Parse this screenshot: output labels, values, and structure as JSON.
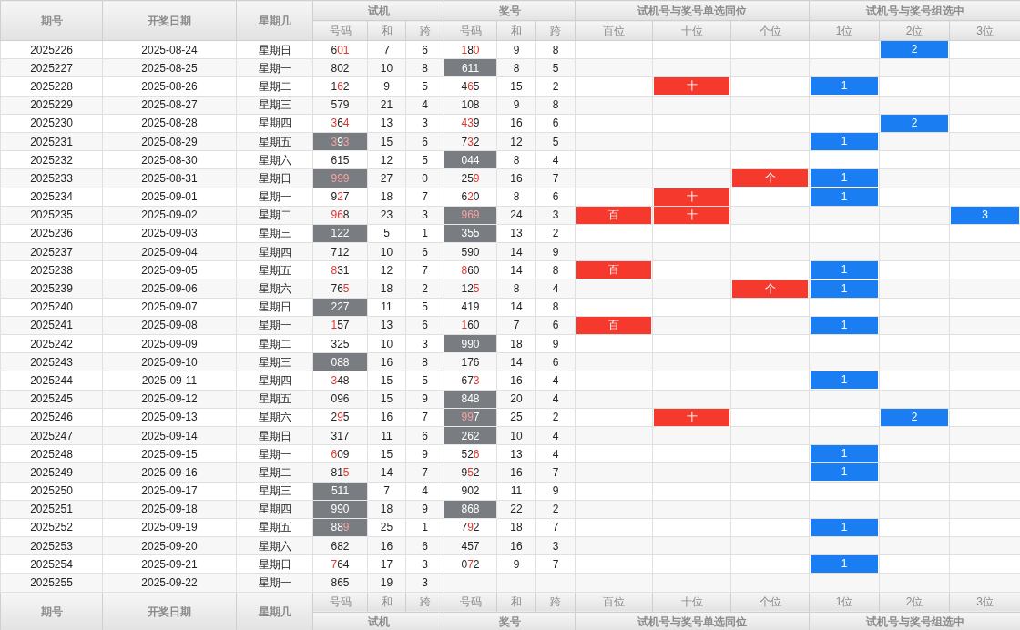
{
  "header": {
    "fixed": [
      "期号",
      "开奖日期",
      "星期几"
    ],
    "groups": [
      {
        "title": "试机",
        "columns": [
          "号码",
          "和",
          "跨"
        ]
      },
      {
        "title": "奖号",
        "columns": [
          "号码",
          "和",
          "跨"
        ]
      },
      {
        "title": "试机号与奖号单选同位",
        "columns": [
          "百位",
          "十位",
          "个位"
        ]
      },
      {
        "title": "试机号与奖号组选中",
        "columns": [
          "1位",
          "2位",
          "3位"
        ]
      }
    ]
  },
  "rows": [
    {
      "issue": "2025226",
      "date": "2025-08-24",
      "weekday": "星期日",
      "trial": {
        "highlighted": false,
        "digits": [
          {
            "d": "6",
            "red": false
          },
          {
            "d": "0",
            "red": true
          },
          {
            "d": "1",
            "red": true
          }
        ],
        "sum": "7",
        "span": "6"
      },
      "draw": {
        "highlighted": false,
        "digits": [
          {
            "d": "1",
            "red": true
          },
          {
            "d": "8",
            "red": false
          },
          {
            "d": "0",
            "red": true
          }
        ],
        "sum": "9",
        "span": "8"
      },
      "hits": [
        {
          "kind": "group2",
          "text": "2"
        }
      ]
    },
    {
      "issue": "2025227",
      "date": "2025-08-25",
      "weekday": "星期一",
      "trial": {
        "highlighted": false,
        "digits": [
          {
            "d": "8",
            "red": false
          },
          {
            "d": "0",
            "red": false
          },
          {
            "d": "2",
            "red": false
          }
        ],
        "sum": "10",
        "span": "8"
      },
      "draw": {
        "highlighted": true,
        "digits": [
          {
            "d": "6",
            "red": false
          },
          {
            "d": "1",
            "red": false
          },
          {
            "d": "1",
            "red": false
          }
        ],
        "sum": "8",
        "span": "5"
      },
      "hits": []
    },
    {
      "issue": "2025228",
      "date": "2025-08-26",
      "weekday": "星期二",
      "trial": {
        "highlighted": false,
        "digits": [
          {
            "d": "1",
            "red": false
          },
          {
            "d": "6",
            "red": true
          },
          {
            "d": "2",
            "red": false
          }
        ],
        "sum": "9",
        "span": "5"
      },
      "draw": {
        "highlighted": false,
        "digits": [
          {
            "d": "4",
            "red": false
          },
          {
            "d": "6",
            "red": true
          },
          {
            "d": "5",
            "red": false
          }
        ],
        "sum": "15",
        "span": "2"
      },
      "hits": [
        {
          "kind": "tens",
          "text": "十"
        },
        {
          "kind": "group1",
          "text": "1"
        }
      ]
    },
    {
      "issue": "2025229",
      "date": "2025-08-27",
      "weekday": "星期三",
      "trial": {
        "highlighted": false,
        "digits": [
          {
            "d": "5",
            "red": false
          },
          {
            "d": "7",
            "red": false
          },
          {
            "d": "9",
            "red": false
          }
        ],
        "sum": "21",
        "span": "4"
      },
      "draw": {
        "highlighted": false,
        "digits": [
          {
            "d": "1",
            "red": false
          },
          {
            "d": "0",
            "red": false
          },
          {
            "d": "8",
            "red": false
          }
        ],
        "sum": "9",
        "span": "8"
      },
      "hits": []
    },
    {
      "issue": "2025230",
      "date": "2025-08-28",
      "weekday": "星期四",
      "trial": {
        "highlighted": false,
        "digits": [
          {
            "d": "3",
            "red": true
          },
          {
            "d": "6",
            "red": false
          },
          {
            "d": "4",
            "red": true
          }
        ],
        "sum": "13",
        "span": "3"
      },
      "draw": {
        "highlighted": false,
        "digits": [
          {
            "d": "4",
            "red": true
          },
          {
            "d": "3",
            "red": true
          },
          {
            "d": "9",
            "red": false
          }
        ],
        "sum": "16",
        "span": "6"
      },
      "hits": [
        {
          "kind": "group2",
          "text": "2"
        }
      ]
    },
    {
      "issue": "2025231",
      "date": "2025-08-29",
      "weekday": "星期五",
      "trial": {
        "highlighted": true,
        "digits": [
          {
            "d": "3",
            "red": true
          },
          {
            "d": "9",
            "red": false
          },
          {
            "d": "3",
            "red": true
          }
        ],
        "sum": "15",
        "span": "6"
      },
      "draw": {
        "highlighted": false,
        "digits": [
          {
            "d": "7",
            "red": false
          },
          {
            "d": "3",
            "red": true
          },
          {
            "d": "2",
            "red": false
          }
        ],
        "sum": "12",
        "span": "5"
      },
      "hits": [
        {
          "kind": "group1",
          "text": "1"
        }
      ]
    },
    {
      "issue": "2025232",
      "date": "2025-08-30",
      "weekday": "星期六",
      "trial": {
        "highlighted": false,
        "digits": [
          {
            "d": "6",
            "red": false
          },
          {
            "d": "1",
            "red": false
          },
          {
            "d": "5",
            "red": false
          }
        ],
        "sum": "12",
        "span": "5"
      },
      "draw": {
        "highlighted": true,
        "digits": [
          {
            "d": "0",
            "red": false
          },
          {
            "d": "4",
            "red": false
          },
          {
            "d": "4",
            "red": false
          }
        ],
        "sum": "8",
        "span": "4"
      },
      "hits": []
    },
    {
      "issue": "2025233",
      "date": "2025-08-31",
      "weekday": "星期日",
      "trial": {
        "highlighted": true,
        "digits": [
          {
            "d": "9",
            "red": true
          },
          {
            "d": "9",
            "red": true
          },
          {
            "d": "9",
            "red": true
          }
        ],
        "sum": "27",
        "span": "0"
      },
      "draw": {
        "highlighted": false,
        "digits": [
          {
            "d": "2",
            "red": false
          },
          {
            "d": "5",
            "red": false
          },
          {
            "d": "9",
            "red": true
          }
        ],
        "sum": "16",
        "span": "7"
      },
      "hits": [
        {
          "kind": "units",
          "text": "个"
        },
        {
          "kind": "group1",
          "text": "1"
        }
      ]
    },
    {
      "issue": "2025234",
      "date": "2025-09-01",
      "weekday": "星期一",
      "trial": {
        "highlighted": false,
        "digits": [
          {
            "d": "9",
            "red": false
          },
          {
            "d": "2",
            "red": true
          },
          {
            "d": "7",
            "red": false
          }
        ],
        "sum": "18",
        "span": "7"
      },
      "draw": {
        "highlighted": false,
        "digits": [
          {
            "d": "6",
            "red": false
          },
          {
            "d": "2",
            "red": true
          },
          {
            "d": "0",
            "red": false
          }
        ],
        "sum": "8",
        "span": "6"
      },
      "hits": [
        {
          "kind": "tens",
          "text": "十"
        },
        {
          "kind": "group1",
          "text": "1"
        }
      ]
    },
    {
      "issue": "2025235",
      "date": "2025-09-02",
      "weekday": "星期二",
      "trial": {
        "highlighted": false,
        "digits": [
          {
            "d": "9",
            "red": true
          },
          {
            "d": "6",
            "red": true
          },
          {
            "d": "8",
            "red": false
          }
        ],
        "sum": "23",
        "span": "3"
      },
      "draw": {
        "highlighted": true,
        "digits": [
          {
            "d": "9",
            "red": true
          },
          {
            "d": "6",
            "red": true
          },
          {
            "d": "9",
            "red": true
          }
        ],
        "sum": "24",
        "span": "3"
      },
      "hits": [
        {
          "kind": "hundreds",
          "text": "百"
        },
        {
          "kind": "tens",
          "text": "十"
        },
        {
          "kind": "group3",
          "text": "3"
        }
      ]
    },
    {
      "issue": "2025236",
      "date": "2025-09-03",
      "weekday": "星期三",
      "trial": {
        "highlighted": true,
        "digits": [
          {
            "d": "1",
            "red": false
          },
          {
            "d": "2",
            "red": false
          },
          {
            "d": "2",
            "red": false
          }
        ],
        "sum": "5",
        "span": "1"
      },
      "draw": {
        "highlighted": true,
        "digits": [
          {
            "d": "3",
            "red": false
          },
          {
            "d": "5",
            "red": false
          },
          {
            "d": "5",
            "red": false
          }
        ],
        "sum": "13",
        "span": "2"
      },
      "hits": []
    },
    {
      "issue": "2025237",
      "date": "2025-09-04",
      "weekday": "星期四",
      "trial": {
        "highlighted": false,
        "digits": [
          {
            "d": "7",
            "red": false
          },
          {
            "d": "1",
            "red": false
          },
          {
            "d": "2",
            "red": false
          }
        ],
        "sum": "10",
        "span": "6"
      },
      "draw": {
        "highlighted": false,
        "digits": [
          {
            "d": "5",
            "red": false
          },
          {
            "d": "9",
            "red": false
          },
          {
            "d": "0",
            "red": false
          }
        ],
        "sum": "14",
        "span": "9"
      },
      "hits": []
    },
    {
      "issue": "2025238",
      "date": "2025-09-05",
      "weekday": "星期五",
      "trial": {
        "highlighted": false,
        "digits": [
          {
            "d": "8",
            "red": true
          },
          {
            "d": "3",
            "red": false
          },
          {
            "d": "1",
            "red": false
          }
        ],
        "sum": "12",
        "span": "7"
      },
      "draw": {
        "highlighted": false,
        "digits": [
          {
            "d": "8",
            "red": true
          },
          {
            "d": "6",
            "red": false
          },
          {
            "d": "0",
            "red": false
          }
        ],
        "sum": "14",
        "span": "8"
      },
      "hits": [
        {
          "kind": "hundreds",
          "text": "百"
        },
        {
          "kind": "group1",
          "text": "1"
        }
      ]
    },
    {
      "issue": "2025239",
      "date": "2025-09-06",
      "weekday": "星期六",
      "trial": {
        "highlighted": false,
        "digits": [
          {
            "d": "7",
            "red": false
          },
          {
            "d": "6",
            "red": false
          },
          {
            "d": "5",
            "red": true
          }
        ],
        "sum": "18",
        "span": "2"
      },
      "draw": {
        "highlighted": false,
        "digits": [
          {
            "d": "1",
            "red": false
          },
          {
            "d": "2",
            "red": false
          },
          {
            "d": "5",
            "red": true
          }
        ],
        "sum": "8",
        "span": "4"
      },
      "hits": [
        {
          "kind": "units",
          "text": "个"
        },
        {
          "kind": "group1",
          "text": "1"
        }
      ]
    },
    {
      "issue": "2025240",
      "date": "2025-09-07",
      "weekday": "星期日",
      "trial": {
        "highlighted": true,
        "digits": [
          {
            "d": "2",
            "red": false
          },
          {
            "d": "2",
            "red": false
          },
          {
            "d": "7",
            "red": false
          }
        ],
        "sum": "11",
        "span": "5"
      },
      "draw": {
        "highlighted": false,
        "digits": [
          {
            "d": "4",
            "red": false
          },
          {
            "d": "1",
            "red": false
          },
          {
            "d": "9",
            "red": false
          }
        ],
        "sum": "14",
        "span": "8"
      },
      "hits": []
    },
    {
      "issue": "2025241",
      "date": "2025-09-08",
      "weekday": "星期一",
      "trial": {
        "highlighted": false,
        "digits": [
          {
            "d": "1",
            "red": true
          },
          {
            "d": "5",
            "red": false
          },
          {
            "d": "7",
            "red": false
          }
        ],
        "sum": "13",
        "span": "6"
      },
      "draw": {
        "highlighted": false,
        "digits": [
          {
            "d": "1",
            "red": true
          },
          {
            "d": "6",
            "red": false
          },
          {
            "d": "0",
            "red": false
          }
        ],
        "sum": "7",
        "span": "6"
      },
      "hits": [
        {
          "kind": "hundreds",
          "text": "百"
        },
        {
          "kind": "group1",
          "text": "1"
        }
      ]
    },
    {
      "issue": "2025242",
      "date": "2025-09-09",
      "weekday": "星期二",
      "trial": {
        "highlighted": false,
        "digits": [
          {
            "d": "3",
            "red": false
          },
          {
            "d": "2",
            "red": false
          },
          {
            "d": "5",
            "red": false
          }
        ],
        "sum": "10",
        "span": "3"
      },
      "draw": {
        "highlighted": true,
        "digits": [
          {
            "d": "9",
            "red": false
          },
          {
            "d": "9",
            "red": false
          },
          {
            "d": "0",
            "red": false
          }
        ],
        "sum": "18",
        "span": "9"
      },
      "hits": []
    },
    {
      "issue": "2025243",
      "date": "2025-09-10",
      "weekday": "星期三",
      "trial": {
        "highlighted": true,
        "digits": [
          {
            "d": "0",
            "red": false
          },
          {
            "d": "8",
            "red": false
          },
          {
            "d": "8",
            "red": false
          }
        ],
        "sum": "16",
        "span": "8"
      },
      "draw": {
        "highlighted": false,
        "digits": [
          {
            "d": "1",
            "red": false
          },
          {
            "d": "7",
            "red": false
          },
          {
            "d": "6",
            "red": false
          }
        ],
        "sum": "14",
        "span": "6"
      },
      "hits": []
    },
    {
      "issue": "2025244",
      "date": "2025-09-11",
      "weekday": "星期四",
      "trial": {
        "highlighted": false,
        "digits": [
          {
            "d": "3",
            "red": true
          },
          {
            "d": "4",
            "red": false
          },
          {
            "d": "8",
            "red": false
          }
        ],
        "sum": "15",
        "span": "5"
      },
      "draw": {
        "highlighted": false,
        "digits": [
          {
            "d": "6",
            "red": false
          },
          {
            "d": "7",
            "red": false
          },
          {
            "d": "3",
            "red": true
          }
        ],
        "sum": "16",
        "span": "4"
      },
      "hits": [
        {
          "kind": "group1",
          "text": "1"
        }
      ]
    },
    {
      "issue": "2025245",
      "date": "2025-09-12",
      "weekday": "星期五",
      "trial": {
        "highlighted": false,
        "digits": [
          {
            "d": "0",
            "red": false
          },
          {
            "d": "9",
            "red": false
          },
          {
            "d": "6",
            "red": false
          }
        ],
        "sum": "15",
        "span": "9"
      },
      "draw": {
        "highlighted": true,
        "digits": [
          {
            "d": "8",
            "red": false
          },
          {
            "d": "4",
            "red": false
          },
          {
            "d": "8",
            "red": false
          }
        ],
        "sum": "20",
        "span": "4"
      },
      "hits": []
    },
    {
      "issue": "2025246",
      "date": "2025-09-13",
      "weekday": "星期六",
      "trial": {
        "highlighted": false,
        "digits": [
          {
            "d": "2",
            "red": false
          },
          {
            "d": "9",
            "red": true
          },
          {
            "d": "5",
            "red": false
          }
        ],
        "sum": "16",
        "span": "7"
      },
      "draw": {
        "highlighted": true,
        "digits": [
          {
            "d": "9",
            "red": true
          },
          {
            "d": "9",
            "red": true
          },
          {
            "d": "7",
            "red": false
          }
        ],
        "sum": "25",
        "span": "2"
      },
      "hits": [
        {
          "kind": "tens",
          "text": "十"
        },
        {
          "kind": "group2",
          "text": "2"
        }
      ]
    },
    {
      "issue": "2025247",
      "date": "2025-09-14",
      "weekday": "星期日",
      "trial": {
        "highlighted": false,
        "digits": [
          {
            "d": "3",
            "red": false
          },
          {
            "d": "1",
            "red": false
          },
          {
            "d": "7",
            "red": false
          }
        ],
        "sum": "11",
        "span": "6"
      },
      "draw": {
        "highlighted": true,
        "digits": [
          {
            "d": "2",
            "red": false
          },
          {
            "d": "6",
            "red": false
          },
          {
            "d": "2",
            "red": false
          }
        ],
        "sum": "10",
        "span": "4"
      },
      "hits": []
    },
    {
      "issue": "2025248",
      "date": "2025-09-15",
      "weekday": "星期一",
      "trial": {
        "highlighted": false,
        "digits": [
          {
            "d": "6",
            "red": true
          },
          {
            "d": "0",
            "red": false
          },
          {
            "d": "9",
            "red": false
          }
        ],
        "sum": "15",
        "span": "9"
      },
      "draw": {
        "highlighted": false,
        "digits": [
          {
            "d": "5",
            "red": false
          },
          {
            "d": "2",
            "red": false
          },
          {
            "d": "6",
            "red": true
          }
        ],
        "sum": "13",
        "span": "4"
      },
      "hits": [
        {
          "kind": "group1",
          "text": "1"
        }
      ]
    },
    {
      "issue": "2025249",
      "date": "2025-09-16",
      "weekday": "星期二",
      "trial": {
        "highlighted": false,
        "digits": [
          {
            "d": "8",
            "red": false
          },
          {
            "d": "1",
            "red": false
          },
          {
            "d": "5",
            "red": true
          }
        ],
        "sum": "14",
        "span": "7"
      },
      "draw": {
        "highlighted": false,
        "digits": [
          {
            "d": "9",
            "red": false
          },
          {
            "d": "5",
            "red": true
          },
          {
            "d": "2",
            "red": false
          }
        ],
        "sum": "16",
        "span": "7"
      },
      "hits": [
        {
          "kind": "group1",
          "text": "1"
        }
      ]
    },
    {
      "issue": "2025250",
      "date": "2025-09-17",
      "weekday": "星期三",
      "trial": {
        "highlighted": true,
        "digits": [
          {
            "d": "5",
            "red": false
          },
          {
            "d": "1",
            "red": false
          },
          {
            "d": "1",
            "red": false
          }
        ],
        "sum": "7",
        "span": "4"
      },
      "draw": {
        "highlighted": false,
        "digits": [
          {
            "d": "9",
            "red": false
          },
          {
            "d": "0",
            "red": false
          },
          {
            "d": "2",
            "red": false
          }
        ],
        "sum": "11",
        "span": "9"
      },
      "hits": []
    },
    {
      "issue": "2025251",
      "date": "2025-09-18",
      "weekday": "星期四",
      "trial": {
        "highlighted": true,
        "digits": [
          {
            "d": "9",
            "red": false
          },
          {
            "d": "9",
            "red": false
          },
          {
            "d": "0",
            "red": false
          }
        ],
        "sum": "18",
        "span": "9"
      },
      "draw": {
        "highlighted": true,
        "digits": [
          {
            "d": "8",
            "red": false
          },
          {
            "d": "6",
            "red": false
          },
          {
            "d": "8",
            "red": false
          }
        ],
        "sum": "22",
        "span": "2"
      },
      "hits": []
    },
    {
      "issue": "2025252",
      "date": "2025-09-19",
      "weekday": "星期五",
      "trial": {
        "highlighted": true,
        "digits": [
          {
            "d": "8",
            "red": false
          },
          {
            "d": "8",
            "red": false
          },
          {
            "d": "9",
            "red": true
          }
        ],
        "sum": "25",
        "span": "1"
      },
      "draw": {
        "highlighted": false,
        "digits": [
          {
            "d": "7",
            "red": false
          },
          {
            "d": "9",
            "red": true
          },
          {
            "d": "2",
            "red": false
          }
        ],
        "sum": "18",
        "span": "7"
      },
      "hits": [
        {
          "kind": "group1",
          "text": "1"
        }
      ]
    },
    {
      "issue": "2025253",
      "date": "2025-09-20",
      "weekday": "星期六",
      "trial": {
        "highlighted": false,
        "digits": [
          {
            "d": "6",
            "red": false
          },
          {
            "d": "8",
            "red": false
          },
          {
            "d": "2",
            "red": false
          }
        ],
        "sum": "16",
        "span": "6"
      },
      "draw": {
        "highlighted": false,
        "digits": [
          {
            "d": "4",
            "red": false
          },
          {
            "d": "5",
            "red": false
          },
          {
            "d": "7",
            "red": false
          }
        ],
        "sum": "16",
        "span": "3"
      },
      "hits": []
    },
    {
      "issue": "2025254",
      "date": "2025-09-21",
      "weekday": "星期日",
      "trial": {
        "highlighted": false,
        "digits": [
          {
            "d": "7",
            "red": true
          },
          {
            "d": "6",
            "red": false
          },
          {
            "d": "4",
            "red": false
          }
        ],
        "sum": "17",
        "span": "3"
      },
      "draw": {
        "highlighted": false,
        "digits": [
          {
            "d": "0",
            "red": false
          },
          {
            "d": "7",
            "red": true
          },
          {
            "d": "2",
            "red": false
          }
        ],
        "sum": "9",
        "span": "7"
      },
      "hits": [
        {
          "kind": "group1",
          "text": "1"
        }
      ]
    },
    {
      "issue": "2025255",
      "date": "2025-09-22",
      "weekday": "星期一",
      "trial": {
        "highlighted": false,
        "digits": [
          {
            "d": "8",
            "red": false
          },
          {
            "d": "6",
            "red": false
          },
          {
            "d": "5",
            "red": false
          }
        ],
        "sum": "19",
        "span": "3"
      },
      "hits": []
    }
  ],
  "footer": {
    "fixed": [
      "期号",
      "开奖日期",
      "星期几"
    ],
    "groups": [
      {
        "title": "试机",
        "columns": [
          "号码",
          "和",
          "跨"
        ]
      },
      {
        "title": "奖号",
        "columns": [
          "号码",
          "和",
          "跨"
        ]
      },
      {
        "title": "试机号与奖号单选同位",
        "columns": [
          "百位",
          "十位",
          "个位"
        ]
      },
      {
        "title": "试机号与奖号组选中",
        "columns": [
          "1位",
          "2位",
          "3位"
        ]
      }
    ]
  }
}
